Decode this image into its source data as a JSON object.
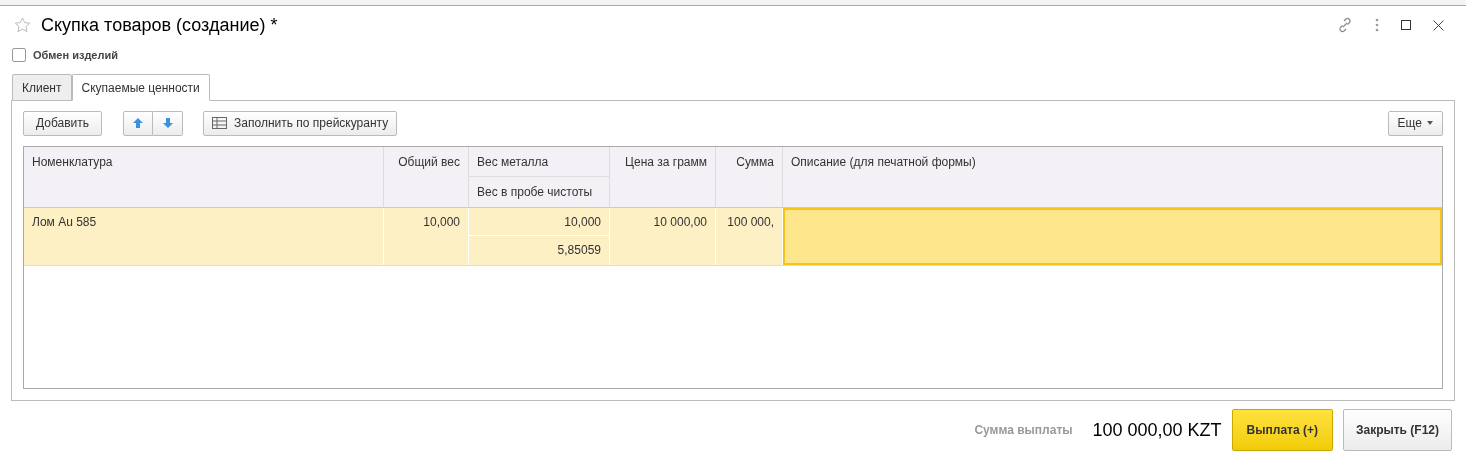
{
  "window": {
    "title": "Скупка товаров (создание) *",
    "favorite": false
  },
  "exchange_checkbox": {
    "label": "Обмен изделий",
    "checked": false
  },
  "tabs": [
    {
      "label": "Клиент",
      "selected": false
    },
    {
      "label": "Скупаемые ценности",
      "selected": true
    }
  ],
  "toolbar": {
    "add": "Добавить",
    "fill": "Заполнить по прейскуранту",
    "more": "Еще"
  },
  "table": {
    "columns": [
      {
        "header": "Номенклатура"
      },
      {
        "header": "Общий вес"
      },
      {
        "header": "Вес металла",
        "subheader": "Вес в пробе чистоты"
      },
      {
        "header": "Цена за грамм"
      },
      {
        "header": "Сумма"
      },
      {
        "header": "Описание (для печатной формы)"
      }
    ],
    "rows": [
      {
        "selected": true,
        "cells": [
          {
            "text": "Лом Au 585",
            "selected": false
          },
          {
            "text": "10,000",
            "selected": false
          },
          {
            "text": "10,000",
            "subtext": "5,85059",
            "selected": false
          },
          {
            "text": "10 000,00",
            "selected": false
          },
          {
            "text": "100 000,",
            "selected": false
          },
          {
            "selected": true
          }
        ]
      }
    ]
  },
  "footer": {
    "label": "Сумма выплаты",
    "total": "100 000,00 KZT",
    "pay": "Выплата (+)",
    "close": "Закрыть (F12)"
  }
}
